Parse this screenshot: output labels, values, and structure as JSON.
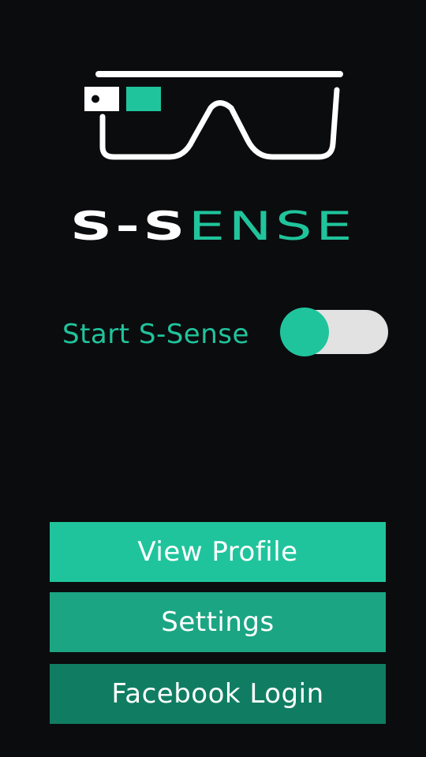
{
  "logo": {
    "brand_part1": "S-S",
    "brand_part2": "ENSE",
    "icon": "smart-glasses-icon"
  },
  "toggle": {
    "label": "Start S-Sense",
    "state": "off"
  },
  "menu": {
    "view_profile": "View Profile",
    "settings": "Settings",
    "facebook_login": "Facebook Login"
  },
  "colors": {
    "background": "#0b0c0e",
    "accent": "#20c49c",
    "settings_button": "#1ca583",
    "facebook_button": "#107d62",
    "toggle_track": "#e2e2e2",
    "text_light": "#ffffff"
  }
}
